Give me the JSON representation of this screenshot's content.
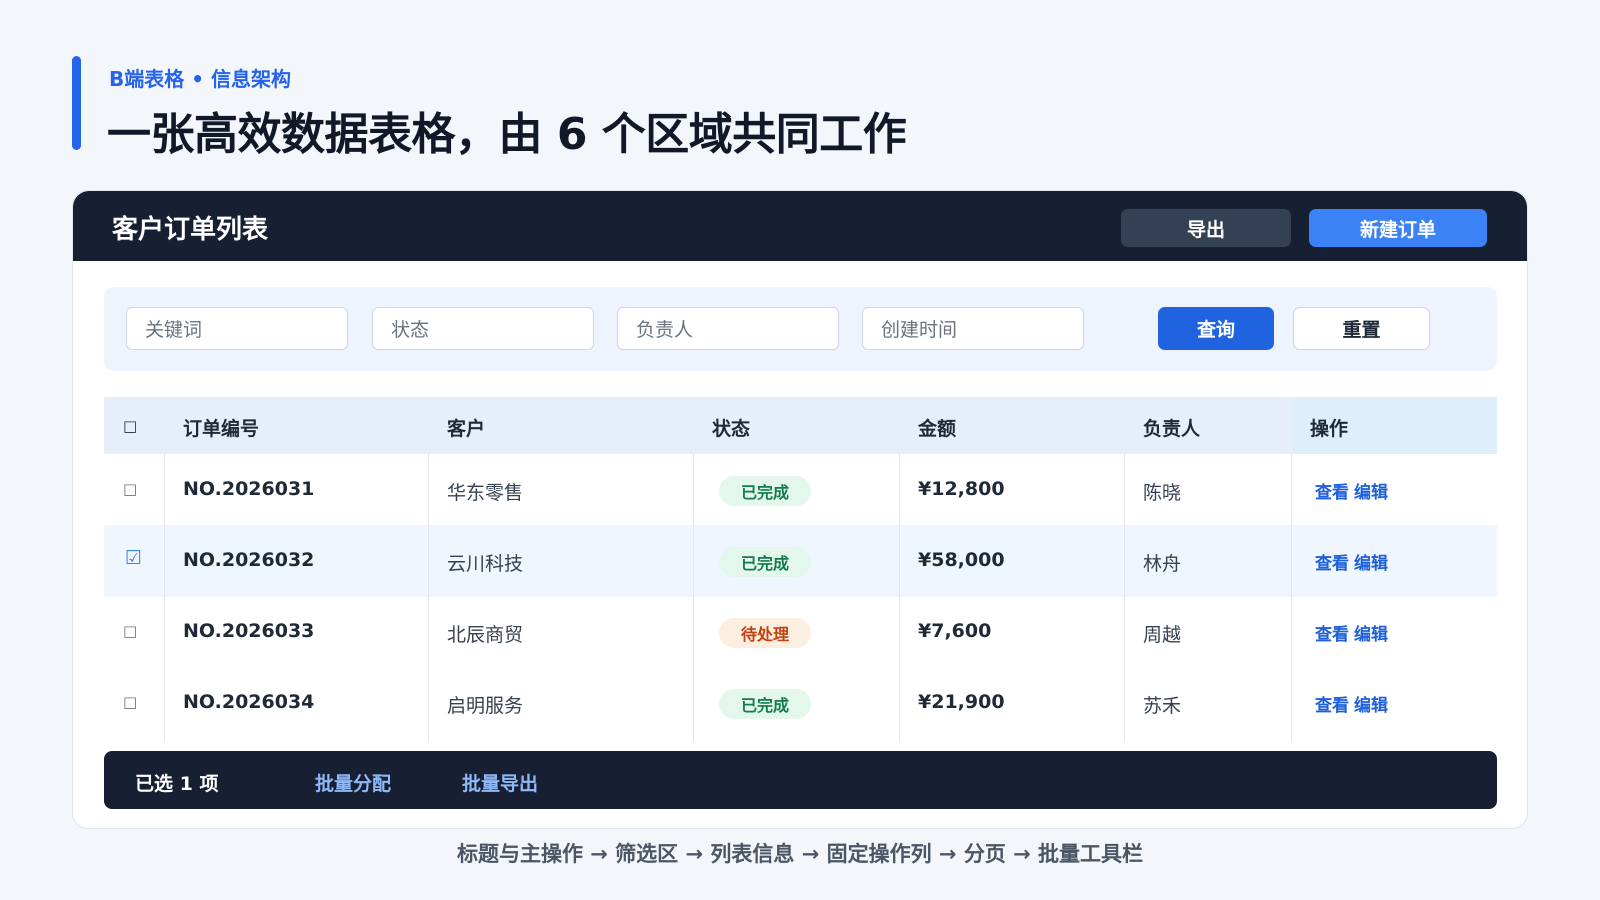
{
  "hero": {
    "eyebrow": "B端表格 • 信息架构",
    "headline": "一张高效数据表格，由 6 个区域共同工作"
  },
  "header": {
    "title": "客户订单列表",
    "export_label": "导出",
    "new_label": "新建订单"
  },
  "filters": {
    "keyword_placeholder": "关键词",
    "status_placeholder": "状态",
    "owner_placeholder": "负责人",
    "created_placeholder": "创建时间",
    "query_label": "查询",
    "reset_label": "重置"
  },
  "table": {
    "columns": [
      "订单编号",
      "客户",
      "状态",
      "金额",
      "负责人",
      "操作"
    ],
    "select_all_glyph": "□",
    "rows": [
      {
        "checked": "□",
        "order_no": "NO.2026031",
        "customer": "华东零售",
        "status": "已完成",
        "amount": "¥12,800",
        "owner": "陈晓",
        "view": "查看",
        "edit": "编辑"
      },
      {
        "checked": "☑",
        "order_no": "NO.2026032",
        "customer": "云川科技",
        "status": "已完成",
        "amount": "¥58,000",
        "owner": "林舟",
        "view": "查看",
        "edit": "编辑"
      },
      {
        "checked": "□",
        "order_no": "NO.2026033",
        "customer": "北辰商贸",
        "status": "待处理",
        "amount": "¥7,600",
        "owner": "周越",
        "view": "查看",
        "edit": "编辑"
      },
      {
        "checked": "□",
        "order_no": "NO.2026034",
        "customer": "启明服务",
        "status": "已完成",
        "amount": "¥21,900",
        "owner": "苏禾",
        "view": "查看",
        "edit": "编辑"
      }
    ]
  },
  "batch": {
    "selected_label": "已选 1 项",
    "assign_label": "批量分配",
    "export_label": "批量导出"
  },
  "flow_caption": "标题与主操作 → 筛选区 → 列表信息 → 固定操作列 → 分页 → 批量工具栏",
  "colors": {
    "accent": "#2563eb",
    "header_bg": "#172033",
    "done_badge": "#127c4a",
    "pending_badge": "#c2410c"
  }
}
